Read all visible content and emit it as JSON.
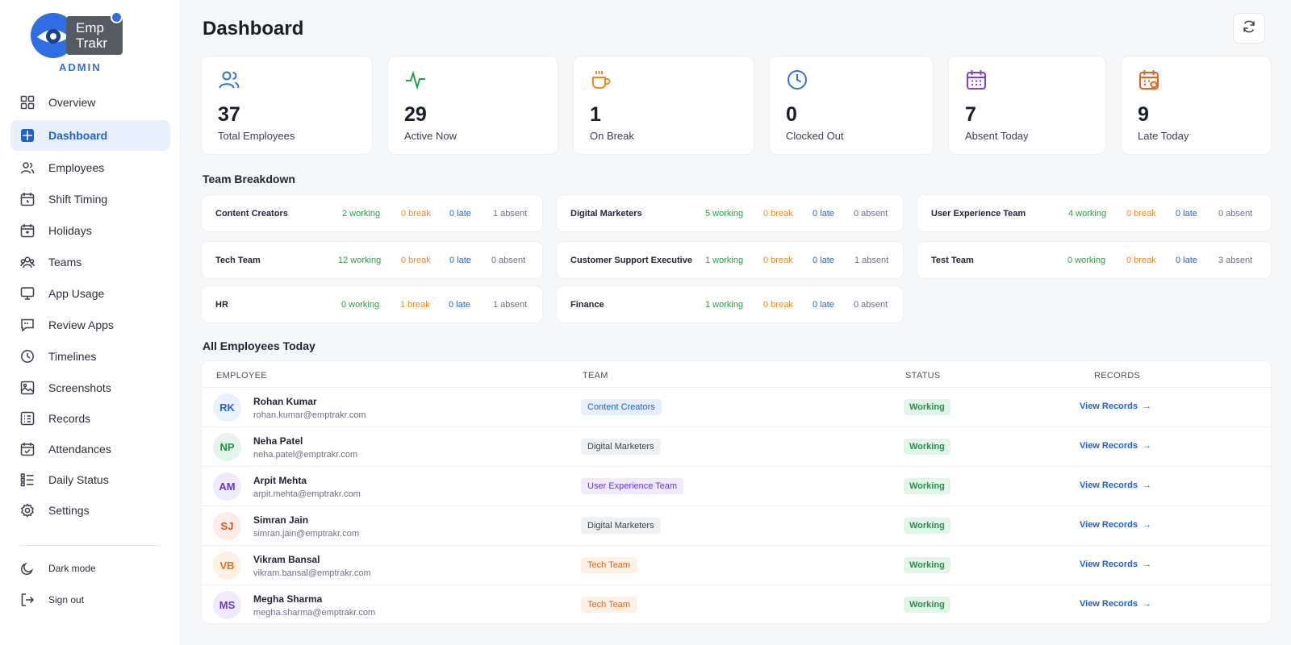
{
  "brand": {
    "name_line1": "Emp",
    "name_line2": "Trakr",
    "role": "ADMIN"
  },
  "sidebar": {
    "items": [
      {
        "label": "Overview",
        "icon": "grid-icon"
      },
      {
        "label": "Dashboard",
        "icon": "dashboard-icon",
        "active": true
      },
      {
        "label": "Employees",
        "icon": "users-icon"
      },
      {
        "label": "Shift Timing",
        "icon": "calendar-clock-icon"
      },
      {
        "label": "Holidays",
        "icon": "calendar-icon"
      },
      {
        "label": "Teams",
        "icon": "team-icon"
      },
      {
        "label": "App Usage",
        "icon": "monitor-icon"
      },
      {
        "label": "Review Apps",
        "icon": "message-icon"
      },
      {
        "label": "Timelines",
        "icon": "clock-icon"
      },
      {
        "label": "Screenshots",
        "icon": "image-icon"
      },
      {
        "label": "Records",
        "icon": "records-icon"
      },
      {
        "label": "Attendances",
        "icon": "calendar-check-icon"
      },
      {
        "label": "Daily Status",
        "icon": "list-icon"
      },
      {
        "label": "Settings",
        "icon": "gear-icon"
      }
    ],
    "bottom": [
      {
        "label": "Dark mode",
        "icon": "moon-icon"
      },
      {
        "label": "Sign out",
        "icon": "sign-out-icon"
      }
    ]
  },
  "header": {
    "title": "Dashboard"
  },
  "stats": [
    {
      "value": "37",
      "label": "Total Employees",
      "icon": "users-icon",
      "color": "#2f6fe3"
    },
    {
      "value": "29",
      "label": "Active Now",
      "icon": "activity-icon",
      "color": "#22a04b"
    },
    {
      "value": "1",
      "label": "On Break",
      "icon": "coffee-icon",
      "color": "#f08a1c"
    },
    {
      "value": "0",
      "label": "Clocked Out",
      "icon": "clock-icon",
      "color": "#2f6fe3"
    },
    {
      "value": "7",
      "label": "Absent Today",
      "icon": "calendar-icon",
      "color": "#7b3fe4"
    },
    {
      "value": "9",
      "label": "Late Today",
      "icon": "calendar-alert-icon",
      "color": "#e2621b"
    }
  ],
  "team_breakdown": {
    "title": "Team Breakdown",
    "teams": [
      {
        "name": "Content Creators",
        "working": "2 working",
        "break": "0 break",
        "late": "0 late",
        "absent": "1 absent"
      },
      {
        "name": "Digital Marketers",
        "working": "5 working",
        "break": "0 break",
        "late": "0 late",
        "absent": "0 absent"
      },
      {
        "name": "User Experience Team",
        "working": "4 working",
        "break": "0 break",
        "late": "0 late",
        "absent": "0 absent"
      },
      {
        "name": "Tech Team",
        "working": "12 working",
        "break": "0 break",
        "late": "0 late",
        "absent": "0 absent"
      },
      {
        "name": "Customer Support Executive",
        "working": "1 working",
        "break": "0 break",
        "late": "0 late",
        "absent": "1 absent"
      },
      {
        "name": "Test Team",
        "working": "0 working",
        "break": "0 break",
        "late": "0 late",
        "absent": "3 absent"
      },
      {
        "name": "HR",
        "working": "0 working",
        "break": "1 break",
        "late": "0 late",
        "absent": "1 absent"
      },
      {
        "name": "Finance",
        "working": "1 working",
        "break": "0 break",
        "late": "0 late",
        "absent": "0 absent"
      }
    ]
  },
  "employees_table": {
    "title": "All Employees Today",
    "columns": [
      "EMPLOYEE",
      "TEAM",
      "STATUS",
      "RECORDS"
    ],
    "rows": [
      {
        "initials": "RK",
        "name": "Rohan Kumar",
        "email": "rohan.kumar@emptrakr.com",
        "team": "Content Creators",
        "status": "Working",
        "link": "View Records"
      },
      {
        "initials": "NP",
        "name": "Neha Patel",
        "email": "neha.patel@emptrakr.com",
        "team": "Digital Marketers",
        "status": "Working",
        "link": "View Records"
      },
      {
        "initials": "AM",
        "name": "Arpit Mehta",
        "email": "arpit.mehta@emptrakr.com",
        "team": "User Experience Team",
        "status": "Working",
        "link": "View Records"
      },
      {
        "initials": "SJ",
        "name": "Simran Jain",
        "email": "simran.jain@emptrakr.com",
        "team": "Digital Marketers",
        "status": "Working",
        "link": "View Records"
      },
      {
        "initials": "VB",
        "name": "Vikram Bansal",
        "email": "vikram.bansal@emptrakr.com",
        "team": "Tech Team",
        "status": "Working",
        "link": "View Records"
      },
      {
        "initials": "MS",
        "name": "Megha Sharma",
        "email": "megha.sharma@emptrakr.com",
        "team": "Tech Team",
        "status": "Working",
        "link": "View Records"
      }
    ]
  },
  "colors": {
    "accent": "#2f6fe3",
    "working": "#22a04b",
    "break": "#f08a1c",
    "late": "#2466d6",
    "absent": "#6b7080"
  }
}
